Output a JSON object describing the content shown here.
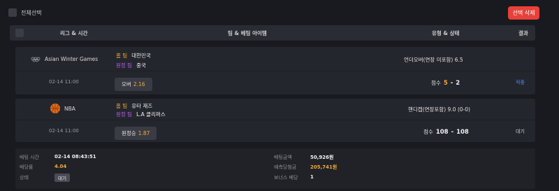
{
  "toolbar": {
    "select_all_label": "전체선택",
    "delete_selected_label": "선택 삭제"
  },
  "table_header": {
    "league_time": "리그 & 시간",
    "team_bet_item": "팀 & 베팅 아이템",
    "type_status": "유형 & 상태",
    "result": "결과"
  },
  "bets": [
    {
      "league": "Asian Winter Games",
      "league_icon": "olympic-rings-icon",
      "datetime": "02-14 11:00",
      "home_tag": "홈 팀",
      "home_team": "대한민국",
      "away_tag": "원정 팀",
      "away_team": "중국",
      "pick": "오버",
      "odds": "2.16",
      "bet_type": "언더오버(연장 미포함) 6.5",
      "score_label": "점수",
      "home_score": "5",
      "score_separator": "-",
      "away_score": "2",
      "result": "적중"
    },
    {
      "league": "NBA",
      "league_icon": "basketball-icon",
      "datetime": "02-14 11:00",
      "home_tag": "홈 팀",
      "home_team": "유타 재즈",
      "away_tag": "원정 팀",
      "away_team": "L.A 클리퍼스",
      "pick": "원정승",
      "odds": "1.87",
      "bet_type": "핸디캡(연장포함) 9.0 (0-0)",
      "score_label": "점수",
      "home_score": "108",
      "score_separator": "-",
      "away_score": "108",
      "result": "대기"
    }
  ],
  "summary": {
    "bet_time_label": "배팅 시간",
    "bet_time": "02-14 08:43:51",
    "odds_label": "배당률",
    "odds": "4.04",
    "status_label": "상태",
    "status": "대기",
    "bet_amount_label": "배팅금액",
    "bet_amount": "50,926원",
    "expected_win_label": "예측당첨금",
    "expected_win": "205,741원",
    "bonus_label": "보너스 배당",
    "bonus": "1"
  },
  "colors": {
    "accent_red": "#e8413a",
    "gold": "#f0a93c",
    "purple": "#b45ce8",
    "hit_blue": "#4f8ef0"
  }
}
